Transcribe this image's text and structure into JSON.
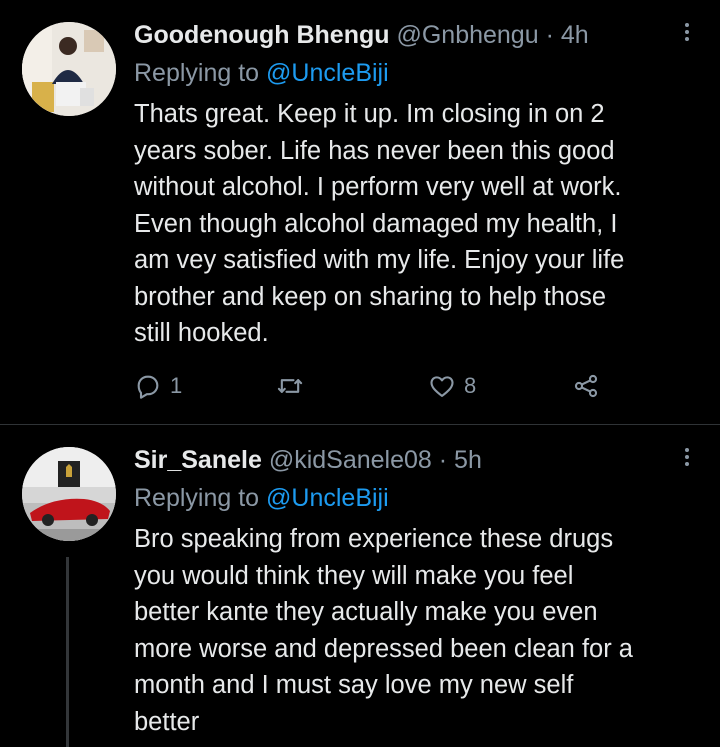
{
  "tweets": [
    {
      "name": "Goodenough Bhengu",
      "handle": "@Gnbhengu",
      "separator": "·",
      "time": "4h",
      "replying_prefix": "Replying to",
      "replying_to": "@UncleBiji",
      "text": "Thats great. Keep it up. Im closing in on 2\nyears sober. Life has never been this good\nwithout alcohol. I perform very well at work.\nEven though alcohol damaged my health, I\nam vey satisfied with my life. Enjoy your life\nbrother and keep on sharing to help those\nstill hooked.",
      "reply_count": "1",
      "retweet_count": "",
      "like_count": "8"
    },
    {
      "name": "Sir_Sanele",
      "handle": "@kidSanele08",
      "separator": "·",
      "time": "5h",
      "replying_prefix": "Replying to",
      "replying_to": "@UncleBiji",
      "text": "Bro speaking from experience these drugs\nyou would think they will make you feel\nbetter kante they actually make you even\nmore worse and depressed been clean for a\nmonth and I must say love my new self\nbetter"
    }
  ],
  "colors": {
    "background": "#000000",
    "text": "#e7e9ea",
    "secondary": "#8b98a5",
    "link": "#1d9bf0",
    "divider": "#2f3336"
  },
  "icons": [
    "reply-icon",
    "retweet-icon",
    "like-icon",
    "share-icon",
    "more-icon"
  ]
}
